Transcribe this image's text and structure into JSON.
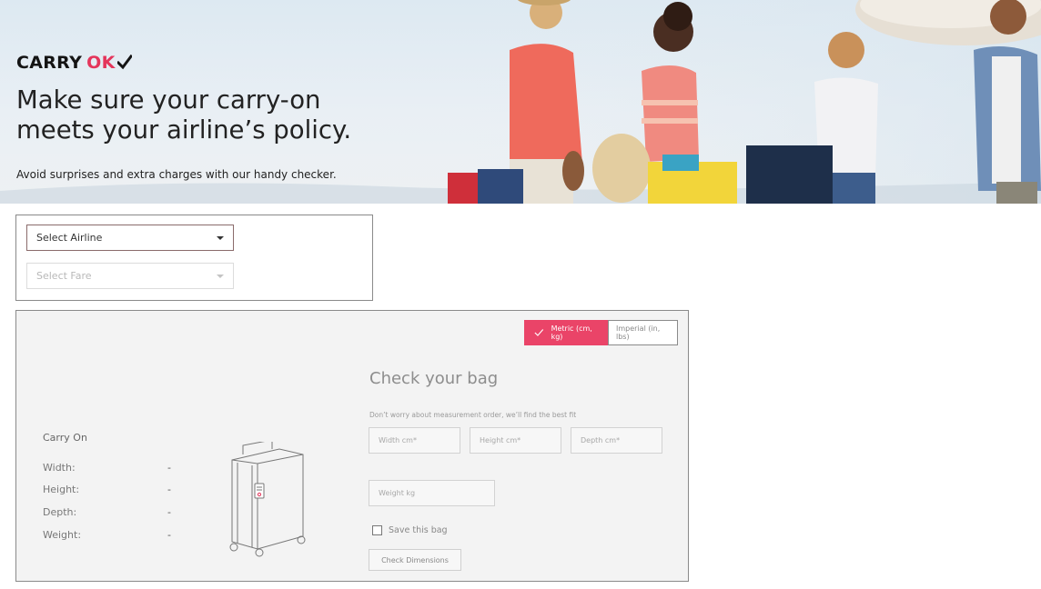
{
  "hero": {
    "logo_carry": "CARRY",
    "logo_ok": "OK",
    "headline_line1": "Make sure your carry-on",
    "headline_line2": "meets your airline’s policy.",
    "subline": "Avoid surprises and extra charges with our handy checker."
  },
  "selectors": {
    "airline": "Select Airline",
    "fare": "Select Fare"
  },
  "units": {
    "metric": "Metric (cm, kg)",
    "imperial": "Imperial (in, lbs)",
    "selected": "metric"
  },
  "carry_on": {
    "title": "Carry On",
    "rows": [
      {
        "label": "Width:",
        "value": "-"
      },
      {
        "label": "Height:",
        "value": "-"
      },
      {
        "label": "Depth:",
        "value": "-"
      },
      {
        "label": "Weight:",
        "value": "-"
      }
    ]
  },
  "checker": {
    "title": "Check your bag",
    "hint": "Don’t worry about measurement order, we’ll find the best fit",
    "width_placeholder": "Width cm*",
    "height_placeholder": "Height cm*",
    "depth_placeholder": "Depth cm*",
    "weight_placeholder": "Weight kg",
    "save_label": "Save this bag",
    "button_label": "Check Dimensions"
  },
  "colors": {
    "accent": "#ea4468",
    "logo_ok": "#e4355b"
  }
}
